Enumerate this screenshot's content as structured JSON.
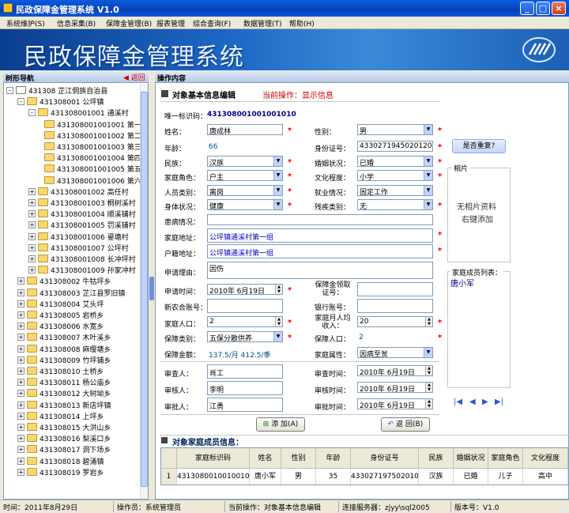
{
  "window": {
    "title": "民政保障金管理系统 V1.0"
  },
  "menu": [
    "系统维护(S)",
    "信息采集(B)",
    "保障金管理(B)",
    "报表管理",
    "综合查询(F)",
    "数据管理(T)",
    "帮助(H)"
  ],
  "banner": {
    "title": "民政保障金管理系统"
  },
  "tree": {
    "header": "树形导航",
    "back_label": "返回",
    "nodes": [
      {
        "label": "431308 芷江侗族自治县",
        "level": 0,
        "expand": "-"
      },
      {
        "label": "431308001 公坪镇",
        "level": 1,
        "expand": "-"
      },
      {
        "label": "431308001001 通溪村",
        "level": 2,
        "expand": "-"
      },
      {
        "label": "431308001001001 第一组",
        "level": 3,
        "expand": ""
      },
      {
        "label": "431308001001002 第二组",
        "level": 3,
        "expand": ""
      },
      {
        "label": "431308001001003 第三组",
        "level": 3,
        "expand": ""
      },
      {
        "label": "431308001001004 第四组",
        "level": 3,
        "expand": ""
      },
      {
        "label": "431308001001005 第五组",
        "level": 3,
        "expand": ""
      },
      {
        "label": "431308001001006 第六组",
        "level": 3,
        "expand": ""
      },
      {
        "label": "431308001002 高任村",
        "level": 2,
        "expand": "+"
      },
      {
        "label": "431308001003 桐树溪村",
        "level": 2,
        "expand": "+"
      },
      {
        "label": "431308001004 顺溪铺村",
        "level": 2,
        "expand": "+"
      },
      {
        "label": "431308001005 罚溪铺村",
        "level": 2,
        "expand": "+"
      },
      {
        "label": "431308001006 鎏塘村",
        "level": 2,
        "expand": "+"
      },
      {
        "label": "431308001007 公坪村",
        "level": 2,
        "expand": "+"
      },
      {
        "label": "431308001008 长冲坪村",
        "level": 2,
        "expand": "+"
      },
      {
        "label": "431308001009 孙家冲村",
        "level": 2,
        "expand": "+"
      },
      {
        "label": "431308002 牛牯坪乡",
        "level": 1,
        "expand": "+"
      },
      {
        "label": "431308003 芷江县罗旧镇",
        "level": 1,
        "expand": "+"
      },
      {
        "label": "431308004 艾头坪",
        "level": 1,
        "expand": "+"
      },
      {
        "label": "431308005 岩桥乡",
        "level": 1,
        "expand": "+"
      },
      {
        "label": "431308006 水宽乡",
        "level": 1,
        "expand": "+"
      },
      {
        "label": "431308007 木叶溪乡",
        "level": 1,
        "expand": "+"
      },
      {
        "label": "431308008 麻缨塘乡",
        "level": 1,
        "expand": "+"
      },
      {
        "label": "431308009 竹坪铺乡",
        "level": 1,
        "expand": "+"
      },
      {
        "label": "431308010 土桥乡",
        "level": 1,
        "expand": "+"
      },
      {
        "label": "431308011 杨公庙乡",
        "level": 1,
        "expand": "+"
      },
      {
        "label": "431308012 大树坳乡",
        "level": 1,
        "expand": "+"
      },
      {
        "label": "431308013 新店坪镇",
        "level": 1,
        "expand": "+"
      },
      {
        "label": "431308014 上坪乡",
        "level": 1,
        "expand": "+"
      },
      {
        "label": "431308015 大洪山乡",
        "level": 1,
        "expand": "+"
      },
      {
        "label": "431308016 梨溪口乡",
        "level": 1,
        "expand": "+"
      },
      {
        "label": "431308017 洞下场乡",
        "level": 1,
        "expand": "+"
      },
      {
        "label": "431308018 碧涌镇",
        "level": 1,
        "expand": "+"
      },
      {
        "label": "431308019 罗岩乡",
        "level": 1,
        "expand": "+"
      }
    ]
  },
  "content": {
    "header": "操作内容",
    "section_title": "对象基本信息编辑",
    "current_op_label": "当前操作：显示信息",
    "uid_label": "唯一标识码：",
    "uid_value": "431308001001001010",
    "name_label": "姓名：",
    "name_value": "唐成林",
    "gender_label": "性别：",
    "gender_value": "男",
    "age_label": "年龄：",
    "age_value": "66",
    "idcard_label": "身份证号：",
    "idcard_value": "433027194502012000",
    "dup_button": "是否重复?",
    "nation_label": "民族：",
    "nation_value": "汉族",
    "marital_label": "婚姻状况：",
    "marital_value": "已婚",
    "role_label": "家庭角色：",
    "role_value": "户主",
    "edu_label": "文化程度：",
    "edu_value": "小学",
    "ptype_label": "人员类别：",
    "ptype_value": "离岗",
    "job_label": "就业情况：",
    "job_value": "固定工作",
    "health_label": "身体状况：",
    "health_value": "健康",
    "disab_label": "残疾类别：",
    "disab_value": "无",
    "illness_label": "患病情况：",
    "illness_value": "",
    "address_label": "家庭地址：",
    "address_value": "公坪镇通溪村第一组",
    "hukou_label": "户籍地址：",
    "hukou_value": "公坪镇通溪村第一组",
    "reason_label": "申请理由：",
    "reason_value": "因伤",
    "apply_time_label": "申请时间：",
    "apply_time_value": "2010年 6月19日",
    "cert_label": "保障金领取证号：",
    "cert_value": "",
    "coop_label": "新农合账号：",
    "coop_value": "",
    "bank_label": "银行账号：",
    "bank_value": "",
    "family_pop_label": "家庭人口：",
    "family_pop_value": "2",
    "income_label": "家庭月人均收入：",
    "income_value": "20",
    "sec_type_label": "保障类别：",
    "sec_type_value": "五保分散供养",
    "sec_pop_label": "保障人口：",
    "sec_pop_value": "2",
    "amount_label": "保障金额：",
    "amount_value": "137.5/月 412.5/季",
    "attr_label": "家庭属性：",
    "attr_value": "因病至贫",
    "reviewer_label": "审查人：",
    "reviewer_value": "肖工",
    "review_time_label": "审查时间：",
    "review_time_value": "2010年 6月19日",
    "checker_label": "审核人：",
    "checker_value": "李明",
    "check_time_label": "审核时间：",
    "check_time_value": "2010年 6月19日",
    "approver_label": "审批人：",
    "approver_value": "江勇",
    "approve_time_label": "审批时间：",
    "approve_time_value": "2010年 6月19日",
    "photo_label": "相片",
    "photo_hint1": "无相片资料",
    "photo_hint2": "右键添加",
    "members_list_label": "家庭成员列表：",
    "members_list_item": "唐小军",
    "add_button": "添 加(A)",
    "back_button": "返 回(B)",
    "grid_title": "对象家庭成员信息："
  },
  "grid": {
    "columns": [
      "家庭标识码",
      "姓名",
      "性别",
      "年龄",
      "身份证号",
      "民族",
      "婚姻状况",
      "家庭角色",
      "文化程度"
    ],
    "rows": [
      [
        "1",
        "431308001001001010",
        "唐小军",
        "男",
        "35",
        "433027197502010130",
        "汉族",
        "已婚",
        "儿子",
        "高中"
      ]
    ]
  },
  "status": {
    "time": "时间：2011年8月29日",
    "operator": "操作员：系统管理员",
    "current": "当前操作：对象基本信息编辑",
    "server": "连接服务器：zjyy\\sql2005",
    "version": "版本号：V1.0"
  },
  "colors": {
    "accent": "#0a5be0",
    "required": "#e00000",
    "value_text": "#00508c"
  }
}
